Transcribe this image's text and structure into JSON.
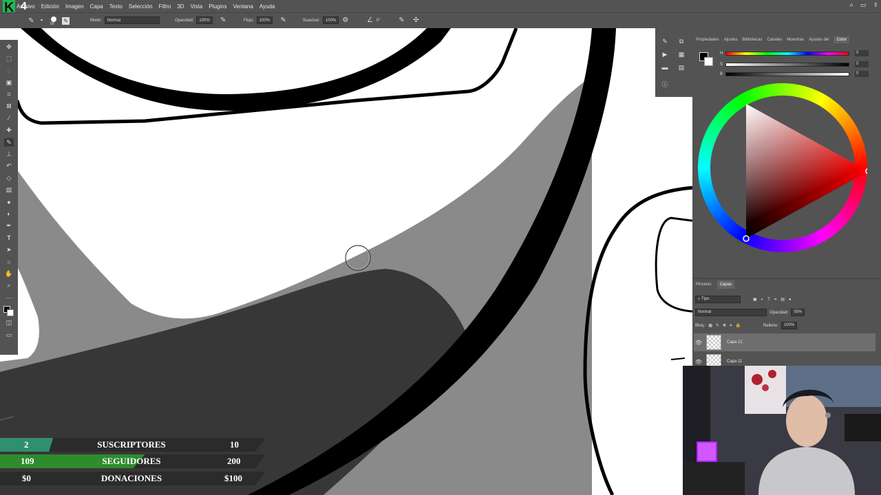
{
  "menu": {
    "items": [
      "Archivo",
      "Edición",
      "Imagen",
      "Capa",
      "Texto",
      "Selección",
      "Filtro",
      "3D",
      "Vista",
      "Plugins",
      "Ventana",
      "Ayuda"
    ]
  },
  "logo": {
    "letter": "K",
    "number": "4"
  },
  "options": {
    "mode_label": "Modo:",
    "mode_value": "Normal",
    "opacity_label": "Opacidad:",
    "opacity_value": "100%",
    "flow_label": "Flujo:",
    "flow_value": "100%",
    "smooth_label": "Suavizar:",
    "smooth_value": "100%",
    "angle_value": "0°",
    "brush_size": "50"
  },
  "panel": {
    "tabs": [
      "Propiedades",
      "Ajustes",
      "Bibliotecas",
      "Canales",
      "Muestras",
      "Ajustes del",
      "Color"
    ],
    "active_tab": "Color",
    "sliders": [
      {
        "label": "H",
        "value": "0"
      },
      {
        "label": "S",
        "value": "0"
      },
      {
        "label": "B",
        "value": "0"
      }
    ],
    "colors": {
      "foreground": "#000000",
      "background": "#ffffff",
      "hue_marker": "#ff0000"
    }
  },
  "layers": {
    "tabs": [
      "Pinceles",
      "Capas"
    ],
    "active_tab": "Capas",
    "filter_label": "Tipo",
    "blend_mode": "Normal",
    "opacity_label": "Opacidad:",
    "opacity_value": "55%",
    "lock_label": "Bloq.:",
    "fill_label": "Relleno:",
    "fill_value": "100%",
    "items": [
      {
        "name": "Capa 12",
        "selected": true
      },
      {
        "name": "Capa 11",
        "selected": false
      }
    ]
  },
  "overlay": {
    "rows": [
      {
        "left": "2",
        "label": "SUSCRIPTORES",
        "right": "10",
        "progress": 0.2
      },
      {
        "left": "109",
        "label": "SEGUIDORES",
        "right": "200",
        "progress": 0.545
      },
      {
        "left": "$0",
        "label": "DONACIONES",
        "right": "$100",
        "progress": 0.0
      }
    ],
    "colors": {
      "subs": "#2f8f6f",
      "followers": "#2e8b2e",
      "track": "#2b2b2b"
    }
  }
}
